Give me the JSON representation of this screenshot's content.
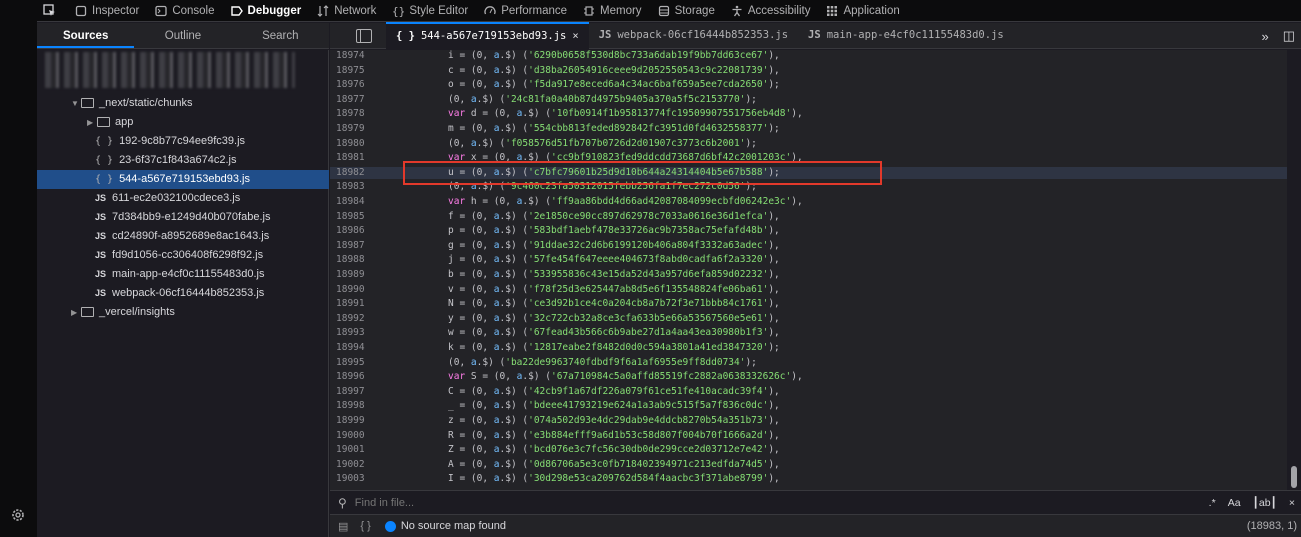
{
  "toolbar": {
    "tabs": [
      {
        "label": "Inspector",
        "icon": "inspector-icon"
      },
      {
        "label": "Console",
        "icon": "console-icon"
      },
      {
        "label": "Debugger",
        "icon": "debugger-icon",
        "active": true
      },
      {
        "label": "Network",
        "icon": "network-icon"
      },
      {
        "label": "Style Editor",
        "icon": "style-editor-icon"
      },
      {
        "label": "Performance",
        "icon": "performance-icon"
      },
      {
        "label": "Memory",
        "icon": "memory-icon"
      },
      {
        "label": "Storage",
        "icon": "storage-icon"
      },
      {
        "label": "Accessibility",
        "icon": "accessibility-icon"
      },
      {
        "label": "Application",
        "icon": "application-icon"
      }
    ]
  },
  "sources_panel": {
    "tabs": [
      "Sources",
      "Outline",
      "Search"
    ],
    "tree": [
      {
        "label": "_next/static/chunks",
        "kind": "folder",
        "expanded": true
      },
      {
        "label": "app",
        "kind": "folder",
        "expanded": false
      },
      {
        "label": "192-9c8b77c94ee9fc39.js",
        "kind": "braces"
      },
      {
        "label": "23-6f37c1f843a674c2.js",
        "kind": "braces"
      },
      {
        "label": "544-a567e719153ebd93.js",
        "kind": "braces",
        "selected": true
      },
      {
        "label": "611-ec2e032100cdece3.js",
        "kind": "js"
      },
      {
        "label": "7d384bb9-e1249d40b070fabe.js",
        "kind": "js"
      },
      {
        "label": "cd24890f-a8952689e8ac1643.js",
        "kind": "js"
      },
      {
        "label": "fd9d1056-cc306408f6298f92.js",
        "kind": "js"
      },
      {
        "label": "main-app-e4cf0c11155483d0.js",
        "kind": "js"
      },
      {
        "label": "webpack-06cf16444b852353.js",
        "kind": "js"
      },
      {
        "label": "_vercel/insights",
        "kind": "folder",
        "expanded": false
      }
    ]
  },
  "editor_tabs": [
    {
      "prefix": "{ }",
      "label": "544-a567e719153ebd93.js",
      "close": "×",
      "active": true
    },
    {
      "prefix": "JS",
      "label": "webpack-06cf16444b852353.js"
    },
    {
      "prefix": "JS",
      "label": "main-app-e4cf0c11155483d0.js"
    }
  ],
  "editor_controls": {
    "more": "»",
    "toggle": "◫"
  },
  "code_lines": [
    {
      "n": "18974",
      "text": "i = (0, a.$) ('6290b0658f530d8bc733a6dab19f9bb7dd63ce67'),"
    },
    {
      "n": "18975",
      "text": "c = (0, a.$) ('d38ba26054916ceee9d2052550543c9c22081739'),"
    },
    {
      "n": "18976",
      "text": "o = (0, a.$) ('f5da917e8eced6a4c34ac6baf659a5ee7cda2650');"
    },
    {
      "n": "18977",
      "text": "(0, a.$) ('24c81fa0a40b87d4975b9405a370a5f5c2153770');"
    },
    {
      "n": "18978",
      "text": "var d = (0, a.$) ('10fb0914f1b95813774fc19509907551756eb4d8'),"
    },
    {
      "n": "18979",
      "text": "m = (0, a.$) ('554cbb813feded892842fc3951d0fd4632558377');"
    },
    {
      "n": "18980",
      "text": "(0, a.$) ('f058576d51fb707b0726d2d01907c3773c6b2001');"
    },
    {
      "n": "18981",
      "text": "var x = (0, a.$) ('cc9bf910823fed9ddcdd73687d6bf42c2001203c'),"
    },
    {
      "n": "18982",
      "text": "u = (0, a.$) ('c7bfc79601b25d9d10b644a24314404b5e67b588');",
      "current": true
    },
    {
      "n": "18983",
      "text": "(0, a.$) ('9c460c23fa50312015febb256fa1f7ec272c0d56');"
    },
    {
      "n": "18984",
      "text": "var h = (0, a.$) ('ff9aa86bdd4d66ad42087084099ecbfd06242e3c'),"
    },
    {
      "n": "18985",
      "text": "f = (0, a.$) ('2e1850ce90cc897d62978c7033a0616e36d1efca'),"
    },
    {
      "n": "18986",
      "text": "p = (0, a.$) ('583bdf1aebf478e33726ac9b7358ac75efafd48b'),"
    },
    {
      "n": "18987",
      "text": "g = (0, a.$) ('91ddae32c2d6b6199120b406a804f3332a63adec'),"
    },
    {
      "n": "18988",
      "text": "j = (0, a.$) ('57fe454f647eeee404673f8abd0cadfa6f2a3320'),"
    },
    {
      "n": "18989",
      "text": "b = (0, a.$) ('533955836c43e15da52d43a957d6efa859d02232'),"
    },
    {
      "n": "18990",
      "text": "v = (0, a.$) ('f78f25d3e625447ab8d5e6f135548824fe06ba61'),"
    },
    {
      "n": "18991",
      "text": "N = (0, a.$) ('ce3d92b1ce4c0a204cb8a7b72f3e71bbb84c1761'),"
    },
    {
      "n": "18992",
      "text": "y = (0, a.$) ('32c722cb32a8ce3cfa633b5e66a53567560e5e61'),"
    },
    {
      "n": "18993",
      "text": "w = (0, a.$) ('67fead43b566c6b9abe27d1a4aa43ea30980b1f3'),"
    },
    {
      "n": "18994",
      "text": "k = (0, a.$) ('12817eabe2f8482d0d0c594a3801a41ed3847320');"
    },
    {
      "n": "18995",
      "text": "(0, a.$) ('ba22de9963740fdbdf9f6a1af6955e9ff8dd0734');"
    },
    {
      "n": "18996",
      "text": "var S = (0, a.$) ('67a710984c5a0affd85519fc2882a0638332626c'),"
    },
    {
      "n": "18997",
      "text": "C = (0, a.$) ('42cb9f1a67df226a079f61ce51fe410acadc39f4'),"
    },
    {
      "n": "18998",
      "text": "_ = (0, a.$) ('bdeee41793219e624a1a3ab9c515f5a7f836c0dc'),"
    },
    {
      "n": "18999",
      "text": "z = (0, a.$) ('074a502d93e4dc29dab9e4ddcb8270b54a351b73'),"
    },
    {
      "n": "19000",
      "text": "R = (0, a.$) ('e3b884efff9a6d1b53c58d807f004b70f1666a2d'),"
    },
    {
      "n": "19001",
      "text": "Z = (0, a.$) ('bcd076e3c7fc56c30db0de299cce2d03712e7e42'),"
    },
    {
      "n": "19002",
      "text": "A = (0, a.$) ('0d86706a5e3c0fb718402394971c213edfda74d5'),"
    },
    {
      "n": "19003",
      "text": "I = (0, a.$) ('30d298e53ca209762d584f4aacbc3f371abe8799'),"
    }
  ],
  "find_bar": {
    "placeholder": "Find in file...",
    "regex": ".*",
    "case": "Aa",
    "whole_word": "┃ab┃",
    "close": "×"
  },
  "status_bar": {
    "source_map": "No source map found",
    "cursor": "(18983, 1)"
  },
  "colors": {
    "accent": "#0a84ff",
    "selection": "#204e8a",
    "annotation_box": "#e2392b",
    "keyword": "#ff7de9",
    "string": "#86de74"
  }
}
